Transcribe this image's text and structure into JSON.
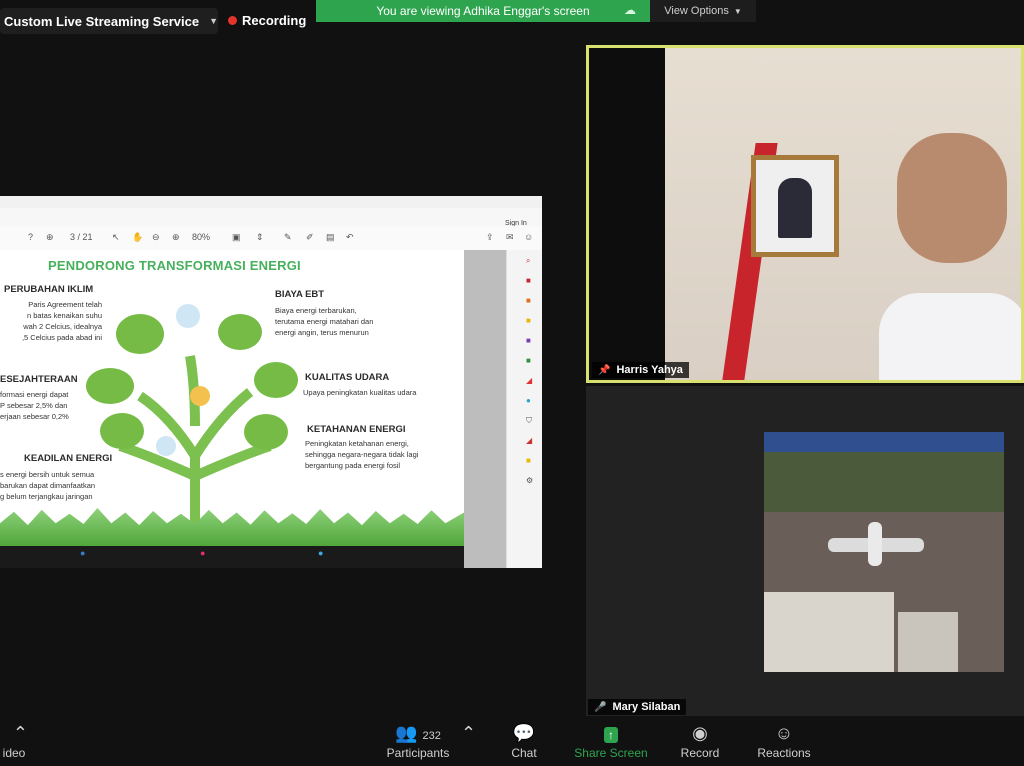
{
  "topbar": {
    "live_label": "Custom Live Streaming Service",
    "recording_label": "Recording",
    "banner_text": "You are viewing Adhika Enggar's screen",
    "view_options_label": "View Options"
  },
  "shared_screen": {
    "signin_label": "Sign In",
    "zoom_value": "80%",
    "page_indicator": "3 / 21",
    "slide": {
      "title": "PENDORONG TRANSFORMASI ENERGI",
      "items": [
        {
          "heading": "PERUBAHAN IKLIM",
          "body": "Paris Agreement telah\nn batas kenaikan suhu\nwah 2 Celcius, idealnya\n,5 Celcius pada abad ini"
        },
        {
          "heading": "ESEJAHTERAAN",
          "body": "formasi energi dapat\nP sebesar 2,5% dan\nerjaan sebesar 0,2%"
        },
        {
          "heading": "KEADILAN ENERGI",
          "body": "s energi bersih untuk semua\nbarukan dapat dimanfaatkan\ng belum terjangkau jaringan"
        },
        {
          "heading": "BIAYA EBT",
          "body": "Biaya energi terbarukan,\nterutama energi matahari dan\nenergi angin, terus menurun"
        },
        {
          "heading": "KUALITAS UDARA",
          "body": "Upaya peningkatan kualitas udara"
        },
        {
          "heading": "KETAHANAN ENERGI",
          "body": "Peningkatan ketahanan energi,\nsehingga negara-negara tidak lagi\nbergantung pada energi fosil"
        }
      ]
    }
  },
  "participants_tiles": [
    {
      "name": "Harris Yahya"
    },
    {
      "name": "Mary Silaban"
    }
  ],
  "toolbar": {
    "video_label": "ideo",
    "participants_label": "Participants",
    "participants_count": "232",
    "chat_label": "Chat",
    "share_label": "Share Screen",
    "record_label": "Record",
    "reactions_label": "Reactions"
  },
  "colors": {
    "share_green": "#2ea44f",
    "active_speaker_border": "#d8e070",
    "recording_red": "#e5342c",
    "slide_title_green": "#47b05c"
  }
}
